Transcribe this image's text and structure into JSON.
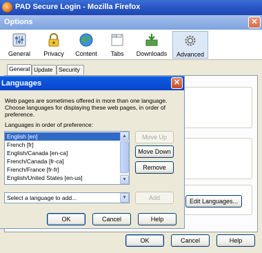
{
  "firefox_window": {
    "title": "PAD Secure Login - Mozilla Firefox"
  },
  "options_window": {
    "title": "Options",
    "close_glyph": "✕",
    "panes": [
      {
        "label": "General",
        "icon": "general-sliders-icon"
      },
      {
        "label": "Privacy",
        "icon": "privacy-lock-icon"
      },
      {
        "label": "Content",
        "icon": "content-globe-icon"
      },
      {
        "label": "Tabs",
        "icon": "tabs-window-icon"
      },
      {
        "label": "Downloads",
        "icon": "downloads-box-icon"
      },
      {
        "label": "Advanced",
        "icon": "advanced-gear-icon"
      }
    ],
    "selected_pane": "Advanced",
    "tabs": [
      "General",
      "Update",
      "Security"
    ],
    "selected_tab": "General",
    "edit_languages_label": "Edit Languages...",
    "ok_label": "OK",
    "cancel_label": "Cancel",
    "help_label": "Help"
  },
  "languages_dialog": {
    "title": "Languages",
    "close_glyph": "✕",
    "description": "Web pages are sometimes offered in more than one language. Choose languages for displaying these web pages, in order of preference.",
    "list_label": "Languages in order of preference:",
    "languages": [
      "English  [en]",
      "French  [fr]",
      "English/Canada  [en-ca]",
      "French/Canada  [fr-ca]",
      "French/France  [fr-fr]",
      "English/United States  [en-us]"
    ],
    "selected_index": 0,
    "move_up_label": "Move Up",
    "move_down_label": "Move Down",
    "remove_label": "Remove",
    "add_placeholder": "Select a language to add...",
    "add_label": "Add",
    "ok_label": "OK",
    "cancel_label": "Cancel",
    "help_label": "Help"
  }
}
